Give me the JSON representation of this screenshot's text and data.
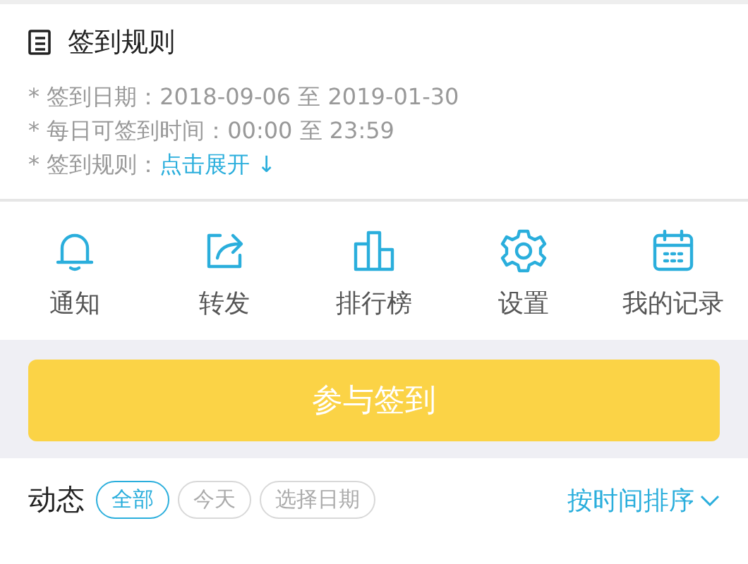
{
  "rules": {
    "title": "签到规则",
    "items": [
      {
        "label": "* 签到日期：",
        "value": "2018-09-06 至 2019-01-30",
        "kind": "text"
      },
      {
        "label": "* 每日可签到时间：",
        "value": "00:00 至 23:59",
        "kind": "text"
      },
      {
        "label": "* 签到规则：",
        "value": "点击展开 ↓",
        "kind": "link"
      }
    ]
  },
  "actions": [
    {
      "label": "通知",
      "kind": "bell"
    },
    {
      "label": "转发",
      "kind": "share"
    },
    {
      "label": "排行榜",
      "kind": "podium"
    },
    {
      "label": "设置",
      "kind": "gear"
    },
    {
      "label": "我的记录",
      "kind": "calendar"
    }
  ],
  "join_button": "参与签到",
  "feed": {
    "title": "动态",
    "filters": [
      {
        "label": "全部",
        "selected": true
      },
      {
        "label": "今天",
        "selected": false
      },
      {
        "label": "选择日期",
        "selected": false
      }
    ],
    "sort": "按时间排序"
  }
}
